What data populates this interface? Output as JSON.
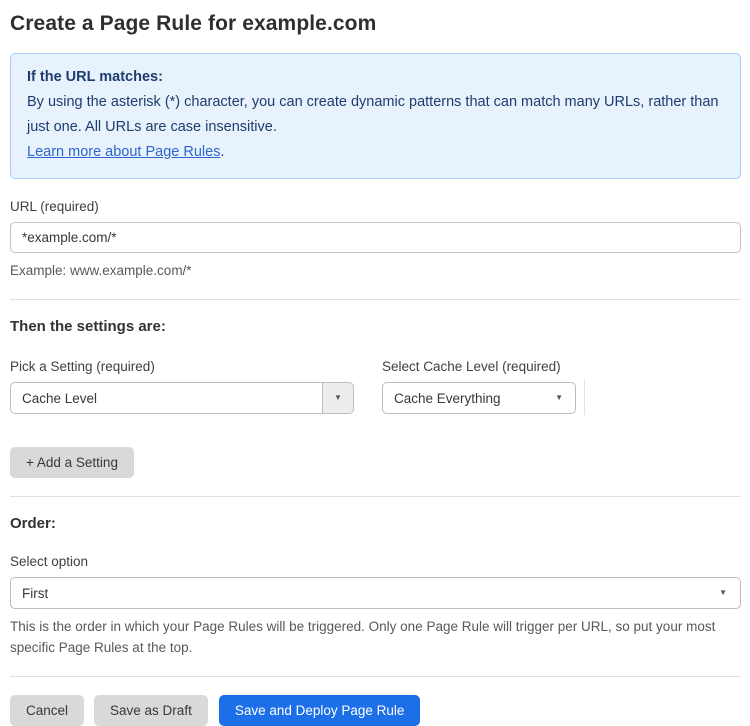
{
  "page": {
    "title": "Create a Page Rule for example.com"
  },
  "info_box": {
    "heading": "If the URL matches:",
    "body": "By using the asterisk (*) character, you can create dynamic patterns that can match many URLs, rather than just one. All URLs are case insensitive.",
    "link_label": "Learn more about Page Rules",
    "link_suffix": "."
  },
  "url_field": {
    "label": "URL (required)",
    "value": "*example.com/*",
    "help": "Example: www.example.com/*"
  },
  "settings_section": {
    "heading": "Then the settings are:",
    "setting_picker": {
      "label": "Pick a Setting (required)",
      "value": "Cache Level"
    },
    "cache_level_picker": {
      "label": "Select Cache Level (required)",
      "value": "Cache Everything"
    },
    "add_setting_label": "+ Add a Setting"
  },
  "order_section": {
    "heading": "Order:",
    "label": "Select option",
    "value": "First",
    "help": "This is the order in which your Page Rules will be triggered. Only one Page Rule will trigger per URL, so put your most specific Page Rules at the top."
  },
  "actions": {
    "cancel_label": "Cancel",
    "save_draft_label": "Save as Draft",
    "save_deploy_label": "Save and Deploy Page Rule"
  },
  "icons": {
    "caret_glyph": "▼"
  },
  "colors": {
    "accent_blue": "#1d6fe8",
    "info_background": "#e8f2fc",
    "info_border": "#a9cdf1",
    "info_text": "#1e3c6e",
    "link_blue": "#2c66cf",
    "button_gray": "#d9d9d9",
    "divider_gray": "#e2e2e2"
  }
}
